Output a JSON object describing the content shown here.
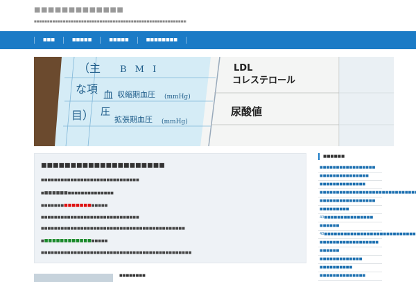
{
  "site": {
    "title": "■■■■■■■■■■■■■",
    "description": "■■■■■■■■■■■■■■■■■■■■■■■■■■■■■■■■■■■■■■■■■■■■■■■■■■■■■■■■■■■■■■■■■■■■■■■■■■"
  },
  "nav": {
    "items": [
      "■■■",
      "■■■■■",
      "■■■■■",
      "■■■■■■■■"
    ]
  },
  "hero": {
    "left_label_top": "（主",
    "left_label_mid": "な項",
    "left_label_bot": "目）",
    "bmi": "B M I",
    "systolic": "収縮期血圧",
    "diastolic": "拡張期血圧",
    "unit1": "(mmHg)",
    "unit2": "(mmHg)",
    "blood": "血",
    "pressure": "圧",
    "ldl": "LDL",
    "cholesterol": "コレステロール",
    "uric": "尿酸値"
  },
  "main": {
    "heading": "■■■■■■■■■■■■■■■■■■■■■",
    "lines": [
      {
        "pre": "■■■■■■■■■■■■■■■■■■■■■■■■■■■■■■",
        "hl": "",
        "post": "",
        "style": ""
      },
      {
        "pre": "■",
        "hl": "■■■■■■",
        "post": "■■■■■■■■■■■■■■",
        "style": "plain"
      },
      {
        "pre": "■■■■■■■",
        "hl": "■■■■■■■",
        "post": "■■■■■",
        "style": "red"
      },
      {
        "pre": "■■■■■■■■■■■■■■■■■■■■■■■■■■■■■■",
        "hl": "",
        "post": "",
        "style": ""
      },
      {
        "pre": "■■■■■■■■■■■■■■■■■■■■■■■■■■■■■■■■■■■■■■■■■■■■",
        "hl": "",
        "post": "",
        "style": ""
      },
      {
        "pre": "■",
        "hl": "■■■■■■■■■■■■",
        "post": "■■■■■",
        "style": "green"
      },
      {
        "pre": "■■■■■■■■■■■■■■■■■■■■■■■■■■■■■■■■■■■■■■■■■■■■■■",
        "hl": "",
        "post": "",
        "style": ""
      }
    ]
  },
  "sidebar": {
    "heading": "■■■■■■",
    "items": [
      "■■■■■■■■■■■■■■■■■",
      "■■■■■■■■■■■■■■■",
      "■■■■■■■■■■■■■■",
      "■■■■■■■■■■■■■■■■■■■■■■■■■■■■■■■■■",
      "■■■■■■■■■■■■■■■■■",
      "■■■■■■■■■",
      "40■■■■■■■■■■■■■■■",
      "■■■■■■",
      "40■■■■■■■■■■■■■■■■■■■■■■■■■■■■■■■■",
      "■■■■■■■■■■■■■■■■■■",
      "■■■■■■",
      "■■■■■■■■■■■■■",
      "■■■■■■■■■■",
      "■■■■■■■■■■■■■■"
    ]
  },
  "post": {
    "title": "■■■■■■■■"
  },
  "colors": {
    "nav_bg": "#1b7bc6",
    "link": "#1b6fb0",
    "highlight_red": "#dd1111",
    "highlight_green": "#1a8a2a",
    "box_bg": "#eef2f6"
  }
}
